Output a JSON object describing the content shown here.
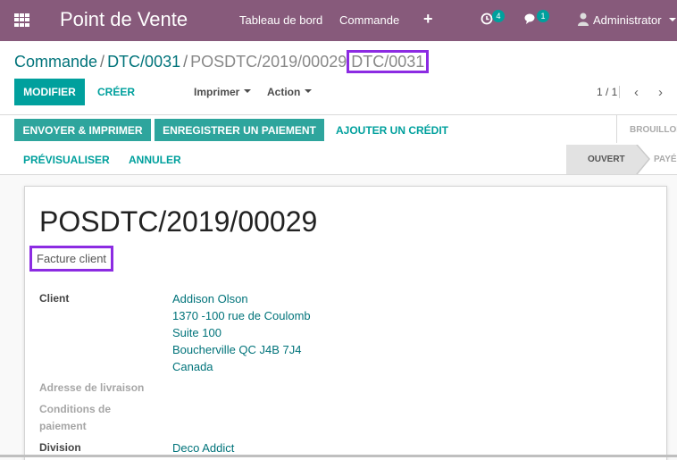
{
  "navbar": {
    "app_title": "Point de Vente",
    "menu": [
      "Tableau de bord",
      "Commande"
    ],
    "add_icon": "+",
    "activity_count": "4",
    "messages_count": "1",
    "user": "Administrator"
  },
  "breadcrumb": {
    "items": [
      "Commande",
      "DTC/0031"
    ],
    "current": "POSDTC/2019/00029",
    "current_suffix": "DTC/0031"
  },
  "control": {
    "edit_label": "MODIFIER",
    "create_label": "CRÉER",
    "print_label": "Imprimer",
    "action_label": "Action",
    "pager": "1 / 1"
  },
  "statusbar": {
    "buttons": [
      "ENVOYER & IMPRIMER",
      "ENREGISTRER UN PAIEMENT",
      "AJOUTER UN CRÉDIT",
      "PRÉVISUALISER",
      "ANNULER"
    ],
    "stages": [
      "BROUILLON",
      "OUVERT",
      "PAYÉ"
    ],
    "active_stage": "OUVERT"
  },
  "document": {
    "title": "POSDTC/2019/00029",
    "type": "Facture client",
    "fields": {
      "client_label": "Client",
      "client_lines": [
        "Addison Olson",
        "1370 -100 rue de Coulomb",
        "Suite 100",
        "Boucherville QC J4B 7J4",
        "Canada"
      ],
      "delivery_label": "Adresse de livraison",
      "terms_label_1": "Conditions de",
      "terms_label_2": "paiement",
      "division_label": "Division",
      "division_value": "Deco Addict"
    }
  },
  "colors": {
    "navbar": "#875a7b",
    "primary": "#00a09d",
    "highlight": "#8c2be2"
  }
}
